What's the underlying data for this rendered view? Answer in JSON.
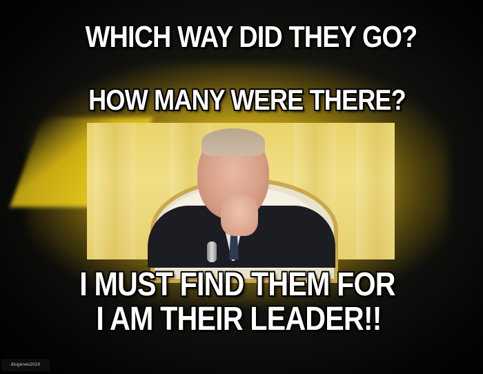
{
  "meme": {
    "top_line_1": "WHICH WAY DID THEY GO?",
    "top_line_2": "HOW MANY WERE THERE?",
    "bottom_line_1": "I MUST FIND THEM FOR",
    "bottom_line_2": "I AM THEIR LEADER!!",
    "watermark": "diogenes2020"
  },
  "colors": {
    "caption_text": "#ffffff",
    "caption_outline": "#000000",
    "glow": "#f0cc14",
    "background": "#000000"
  }
}
